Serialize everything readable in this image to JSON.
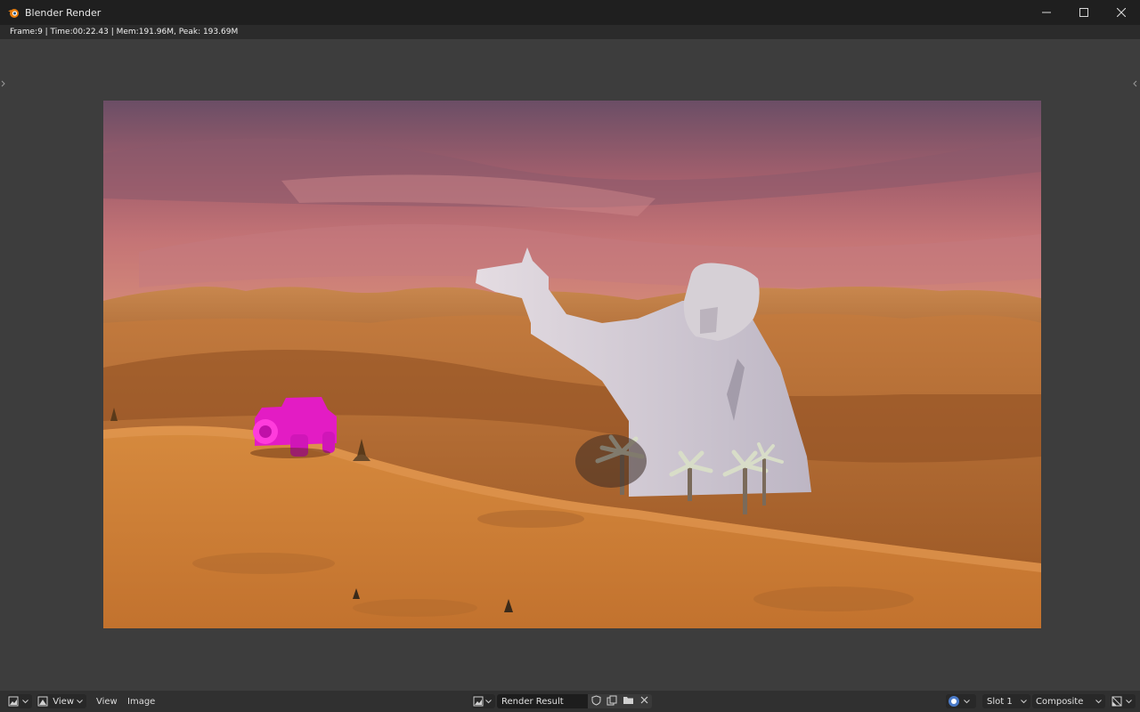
{
  "window": {
    "title": "Blender Render",
    "app_icon": "blender-logo-icon",
    "controls": [
      "minimize-icon",
      "maximize-icon",
      "close-icon"
    ]
  },
  "info_bar": {
    "text": "Frame:9 | Time:00:22.43 | Mem:191.96M, Peak: 193.69M"
  },
  "render": {
    "description_icon": "render-result-image",
    "sky_colors": [
      "#6e4f68",
      "#b46a6e",
      "#d49080"
    ],
    "sand_color": "#c8782c",
    "car_color": "#e820c8",
    "statue_color": "#d9d4d8"
  },
  "footer": {
    "editor_type_icon": "image-editor-icon",
    "view_mode_icon": "view-mode-icon",
    "view_dropdown": "View",
    "menu_view": "View",
    "menu_image": "Image",
    "image_browse_icon": "image-browse-icon",
    "image_name": "Render Result",
    "fake_user_icon": "shield-icon",
    "new_image_icon": "duplicate-icon",
    "open_icon": "folder-icon",
    "unlink_icon": "close-icon",
    "display_channels_icon": "render-channels-icon",
    "slot": "Slot 1",
    "layer": "Composite",
    "scopes_icon": "image-scopes-icon"
  }
}
